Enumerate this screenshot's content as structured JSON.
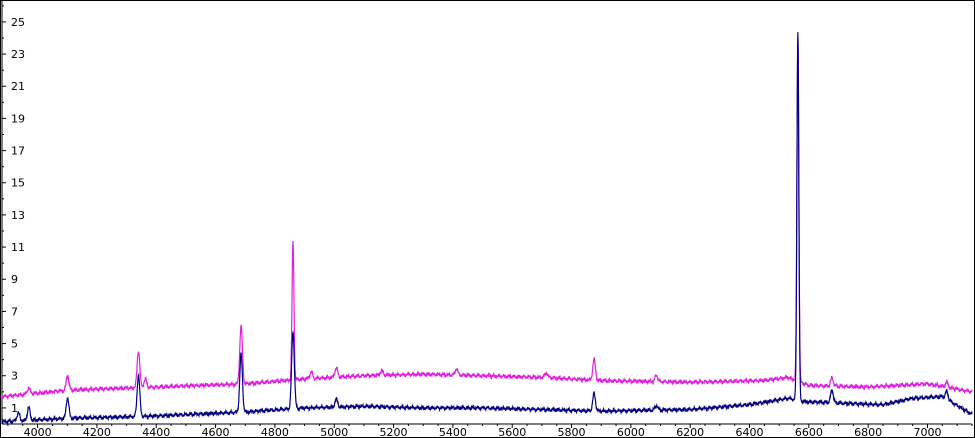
{
  "chart_data": {
    "type": "line",
    "title": "",
    "xlabel": "",
    "ylabel": "",
    "xlim": [
      3880,
      7150
    ],
    "ylim": [
      0,
      26.3
    ],
    "x_ticks": [
      4000,
      4200,
      4400,
      4600,
      4800,
      5000,
      5200,
      5400,
      5600,
      5800,
      6000,
      6200,
      6400,
      6600,
      6800,
      7000
    ],
    "y_ticks": [
      1,
      3,
      5,
      7,
      9,
      11,
      13,
      15,
      17,
      19,
      21,
      23,
      25
    ],
    "grid": false,
    "legend": "none",
    "series": [
      {
        "color": "#e020e0",
        "baseline": [
          [
            3880,
            1.7
          ],
          [
            4100,
            2.1
          ],
          [
            4400,
            2.3
          ],
          [
            4700,
            2.5
          ],
          [
            4900,
            2.8
          ],
          [
            5100,
            3.0
          ],
          [
            5300,
            3.1
          ],
          [
            5500,
            3.0
          ],
          [
            5700,
            2.9
          ],
          [
            5900,
            2.7
          ],
          [
            6200,
            2.6
          ],
          [
            6450,
            2.7
          ],
          [
            6530,
            2.9
          ],
          [
            6600,
            2.4
          ],
          [
            6800,
            2.3
          ],
          [
            7000,
            2.5
          ],
          [
            7150,
            2.0
          ]
        ],
        "peaks": [
          [
            3970,
            0.4
          ],
          [
            4101,
            0.9
          ],
          [
            4340,
            2.3
          ],
          [
            4363,
            0.5
          ],
          [
            4686,
            3.6
          ],
          [
            4861,
            8.6
          ],
          [
            4922,
            0.4
          ],
          [
            5007,
            0.6
          ],
          [
            5160,
            0.3
          ],
          [
            5412,
            0.4
          ],
          [
            5715,
            0.3
          ],
          [
            5876,
            1.3
          ],
          [
            6086,
            0.4
          ],
          [
            6563,
            21.5
          ],
          [
            6678,
            0.5
          ],
          [
            7065,
            0.3
          ]
        ]
      },
      {
        "color": "#000080",
        "baseline": [
          [
            3880,
            0.15
          ],
          [
            4100,
            0.35
          ],
          [
            4400,
            0.5
          ],
          [
            4700,
            0.75
          ],
          [
            4900,
            1.0
          ],
          [
            5100,
            1.1
          ],
          [
            5300,
            1.0
          ],
          [
            5500,
            1.0
          ],
          [
            5700,
            0.9
          ],
          [
            5900,
            0.8
          ],
          [
            6200,
            0.9
          ],
          [
            6400,
            1.2
          ],
          [
            6530,
            1.6
          ],
          [
            6580,
            1.4
          ],
          [
            6700,
            1.3
          ],
          [
            6850,
            1.2
          ],
          [
            6950,
            1.6
          ],
          [
            7050,
            1.7
          ],
          [
            7150,
            0.6
          ]
        ],
        "peaks": [
          [
            3935,
            0.5
          ],
          [
            3970,
            0.8
          ],
          [
            4101,
            1.3
          ],
          [
            4340,
            2.6
          ],
          [
            4686,
            3.6
          ],
          [
            4861,
            4.8
          ],
          [
            5007,
            0.5
          ],
          [
            5876,
            1.1
          ],
          [
            6086,
            0.3
          ],
          [
            6563,
            23.0
          ],
          [
            6678,
            0.8
          ],
          [
            7065,
            0.5
          ]
        ]
      }
    ]
  }
}
